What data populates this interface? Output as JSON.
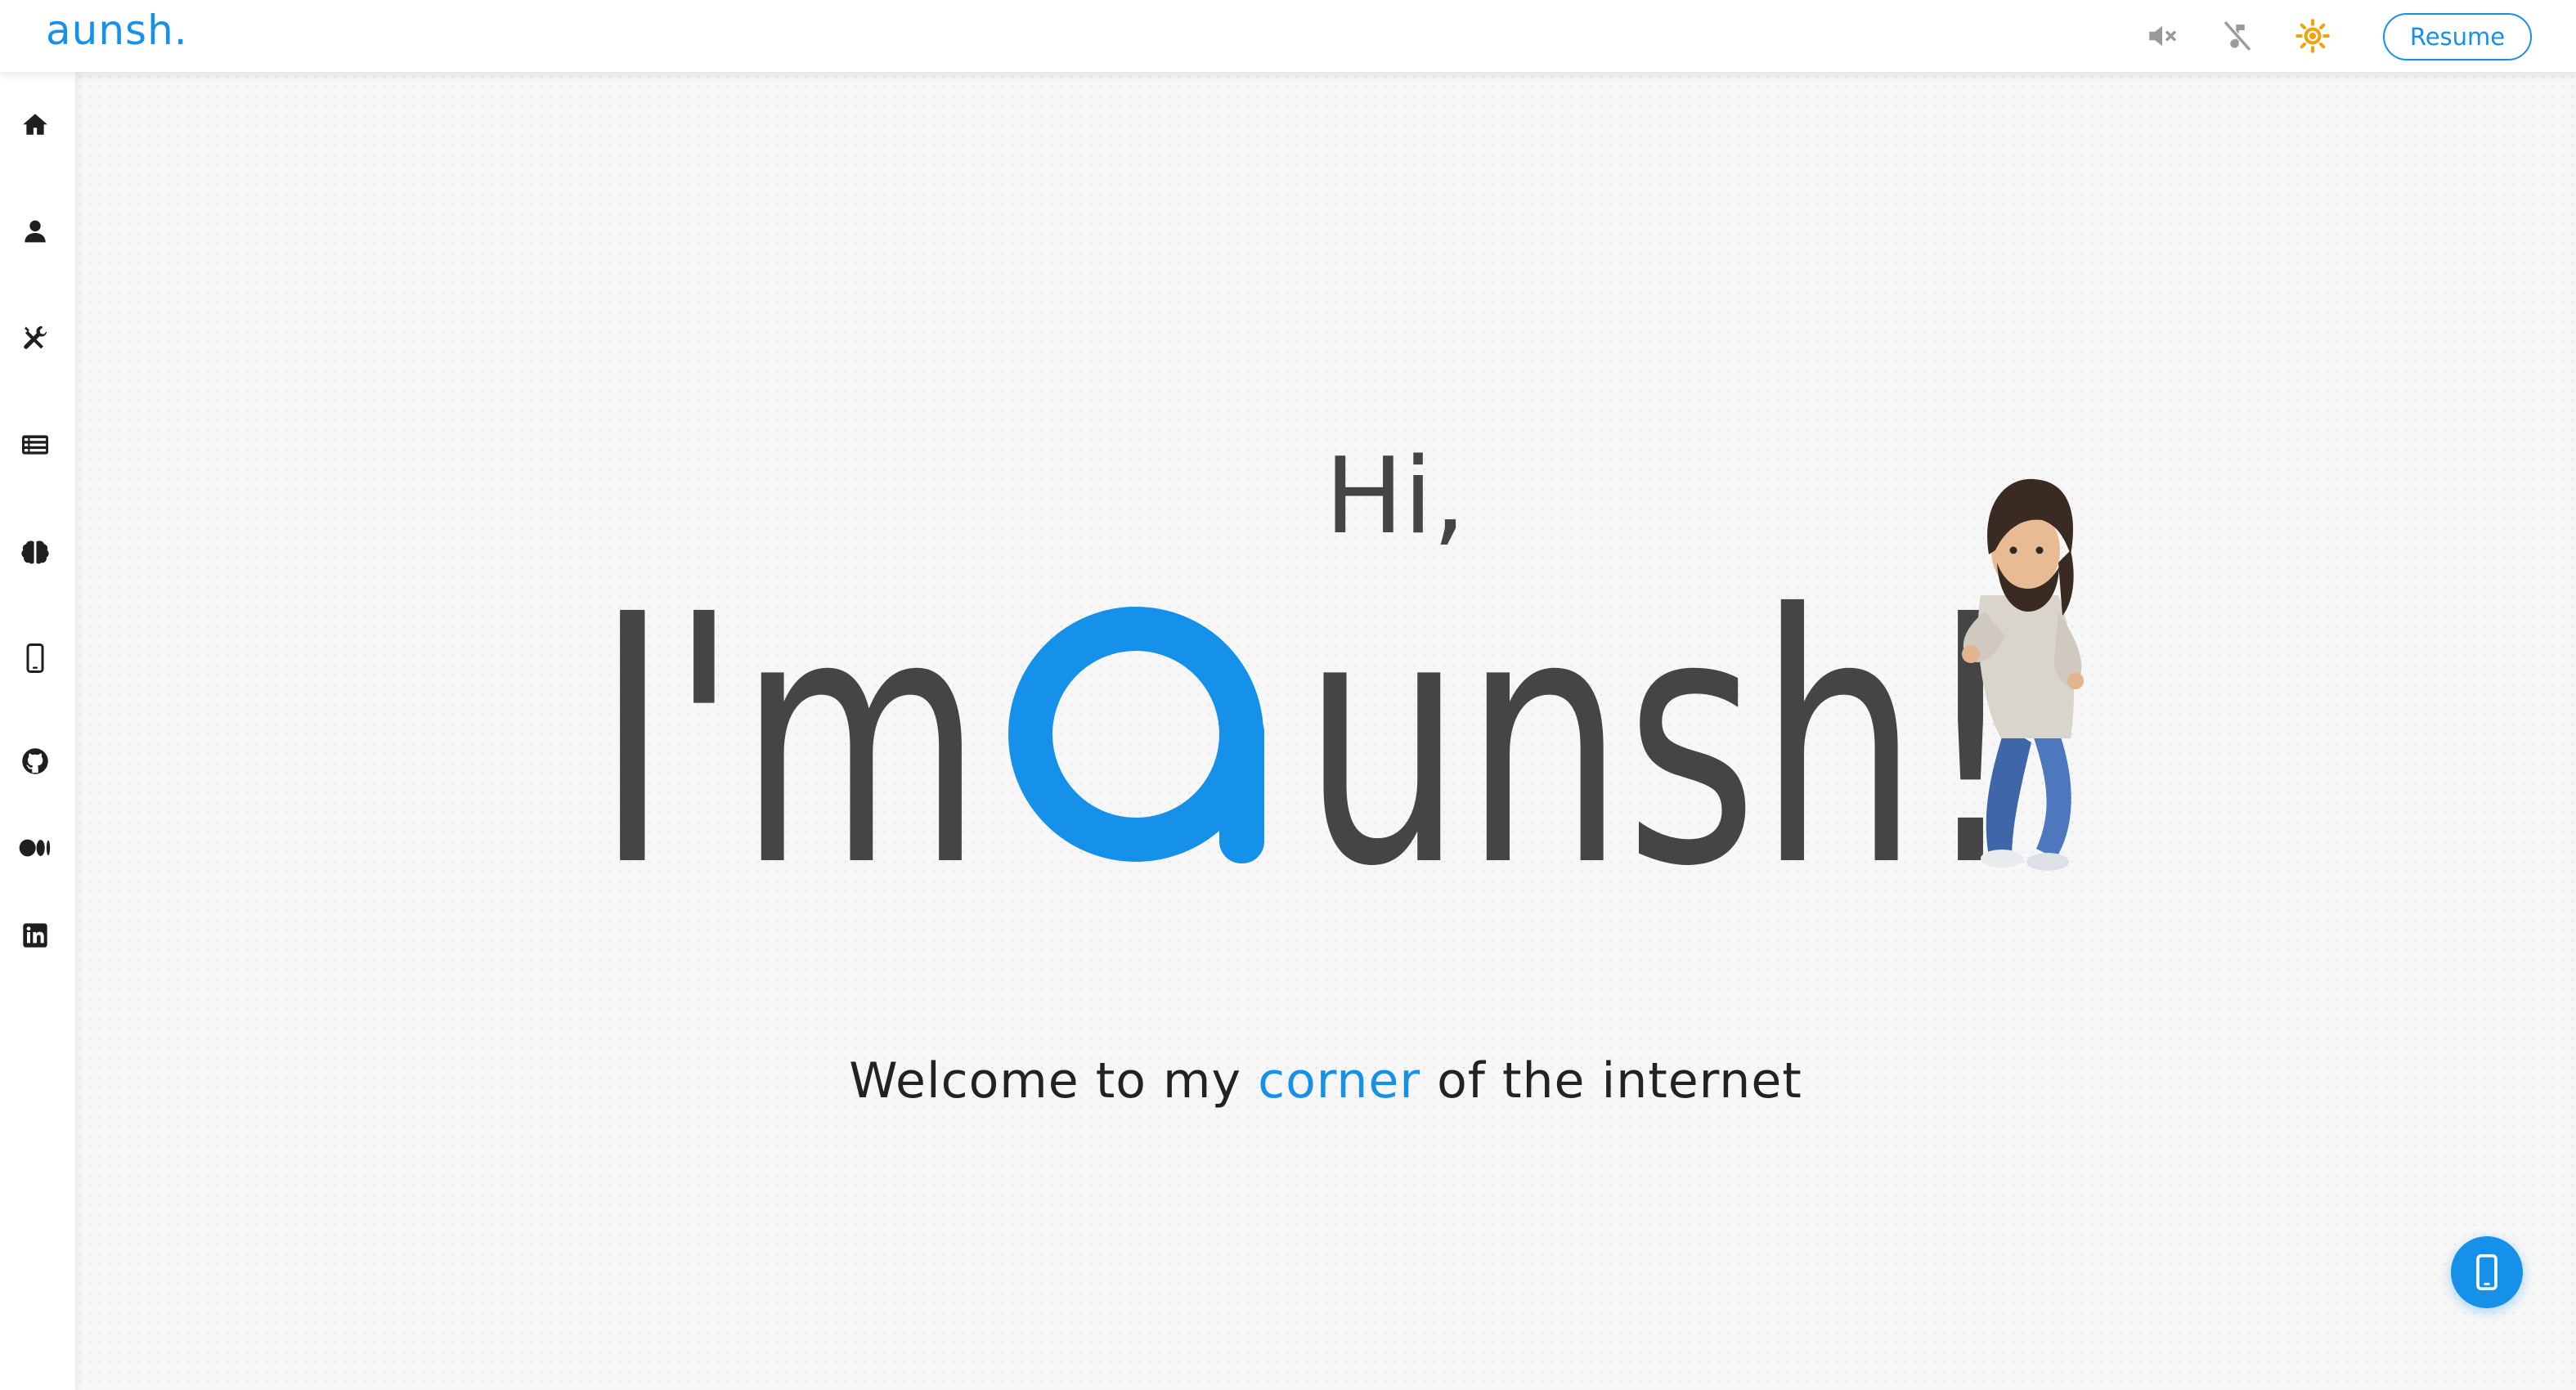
{
  "topbar": {
    "brand": "aunsh.",
    "icons": [
      "sound-muted-icon",
      "music-off-icon",
      "sun-icon"
    ],
    "resume_label": "Resume"
  },
  "sidebar": {
    "items": [
      {
        "name": "home",
        "icon": "home-icon"
      },
      {
        "name": "about",
        "icon": "user-icon"
      },
      {
        "name": "skills",
        "icon": "tools-icon"
      },
      {
        "name": "projects",
        "icon": "list-icon"
      },
      {
        "name": "brain",
        "icon": "brain-icon"
      },
      {
        "name": "contact",
        "icon": "phone-icon"
      },
      {
        "name": "github",
        "icon": "github-icon"
      },
      {
        "name": "medium",
        "icon": "medium-icon"
      },
      {
        "name": "linkedin",
        "icon": "linkedin-icon"
      }
    ]
  },
  "hero": {
    "greeting": "Hi,",
    "intro_prefix": "I'm",
    "name_first_letter": "a",
    "name_rest": "unsh!",
    "tagline_before": "Welcome to my",
    "tagline_accent": "corner",
    "tagline_after": "of the internet"
  },
  "fab": {
    "icon": "phone-icon"
  },
  "colors": {
    "accent": "#1591ea",
    "text_dark": "#454545",
    "sun": "#f2a20c",
    "background": "#f7f7f7"
  }
}
